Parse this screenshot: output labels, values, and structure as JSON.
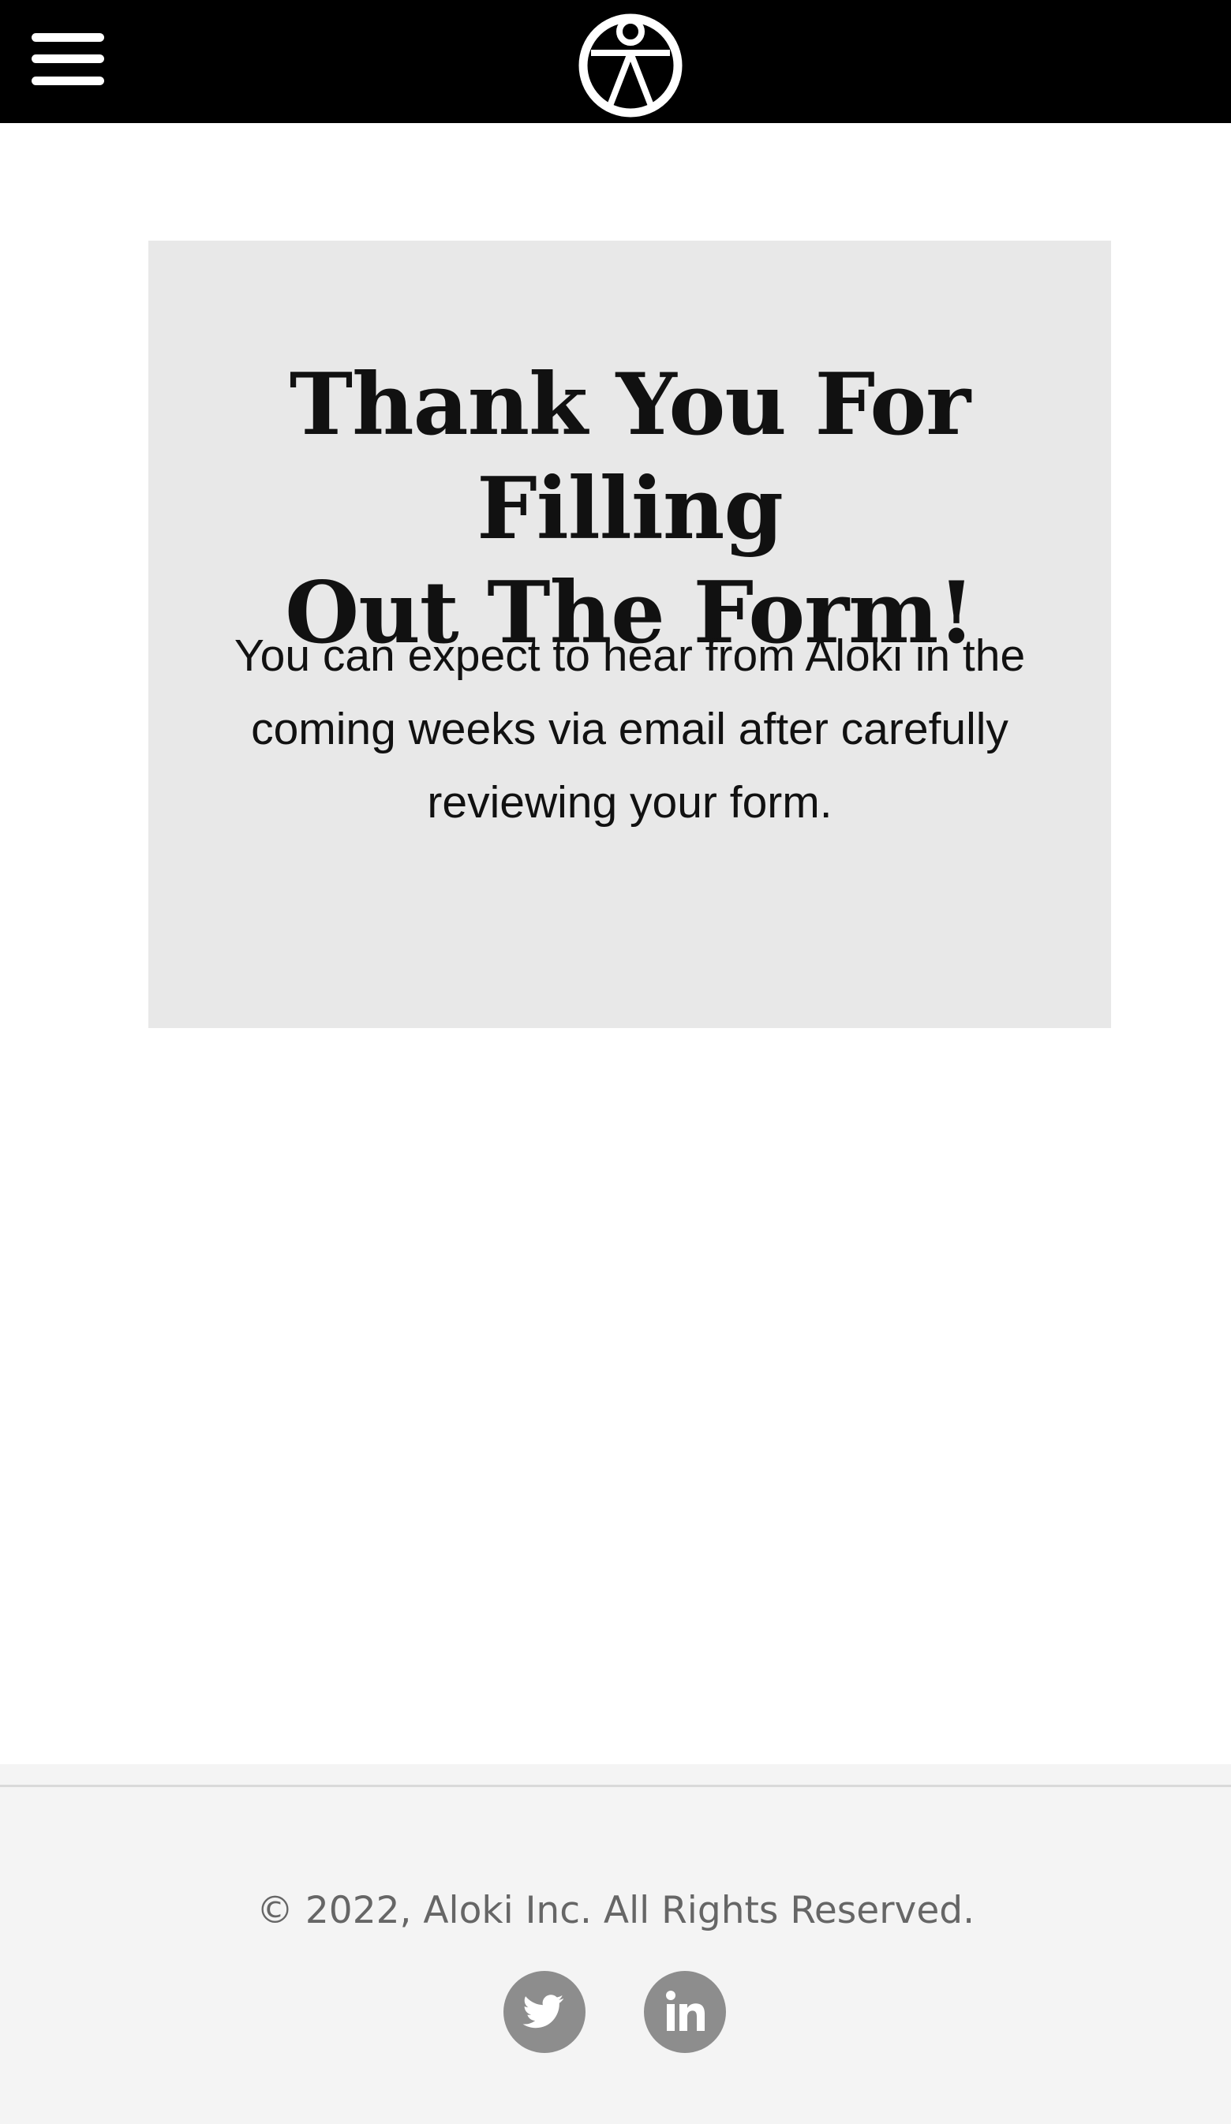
{
  "header": {
    "menu_icon": "hamburger-menu-icon",
    "logo_icon": "aloki-logo-icon",
    "background": "#000000"
  },
  "confirmation": {
    "title_line1": "Thank You For Filling",
    "title_line2": "Out The Form!",
    "message_line1": "You can expect to hear from Aloki in the",
    "message_line2": "coming weeks via email after carefully",
    "message_line3": "reviewing your form.",
    "background": "#e8e8e8"
  },
  "footer": {
    "copyright": "© 2022, Aloki Inc. All Rights Reserved.",
    "social": [
      {
        "icon": "twitter-icon"
      },
      {
        "icon": "linkedin-icon"
      }
    ],
    "background": "#f4f4f4",
    "icon_color": "#8d8d8d"
  }
}
